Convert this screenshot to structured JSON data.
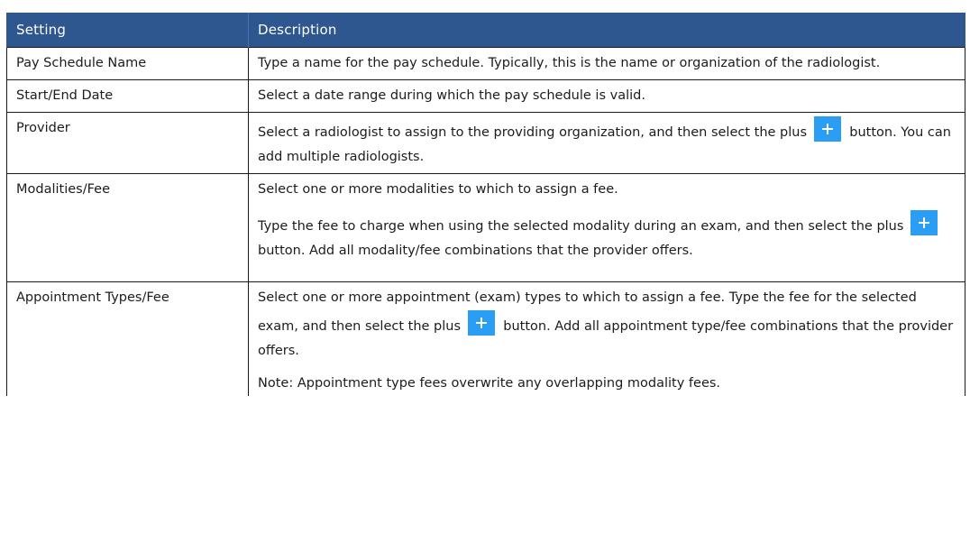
{
  "table": {
    "headers": {
      "setting": "Setting",
      "description": "Description"
    },
    "rows": [
      {
        "setting": "Pay Schedule Name",
        "paragraphs": [
          [
            "Type a name for the pay schedule. Typically, this is the name or organization of the radiologist."
          ]
        ]
      },
      {
        "setting": "Start/End Date",
        "paragraphs": [
          [
            "Select a date range during which the pay schedule is valid."
          ]
        ]
      },
      {
        "setting": "Provider",
        "paragraphs": [
          [
            "Select a radiologist to assign to the providing organization, and then select the plus",
            "button. You can add multiple radiologists."
          ]
        ]
      },
      {
        "setting": "Modalities/Fee",
        "paragraphs": [
          [
            "Select one or more modalities to which to assign a fee."
          ],
          [
            "Type the fee to charge when using the selected modality during an exam, and then select the plus",
            "button. Add all modality/fee combinations that the provider offers."
          ]
        ]
      },
      {
        "setting": "Appointment Types/Fee",
        "paragraphs": [
          [
            "Select one or more appointment (exam) types to which to assign a fee. Type the fee for the selected exam, and then select the plus",
            "button. Add all appointment type/fee combinations that the provider offers."
          ],
          [
            "Note: Appointment type fees overwrite any overlapping modality fees."
          ]
        ]
      }
    ]
  },
  "icons": {
    "plus": "plus-icon"
  },
  "colors": {
    "header_bg": "#2e568f",
    "header_text": "#ffffff",
    "plus_icon_bg": "#2a9df4",
    "border": "#1a1a1a"
  }
}
